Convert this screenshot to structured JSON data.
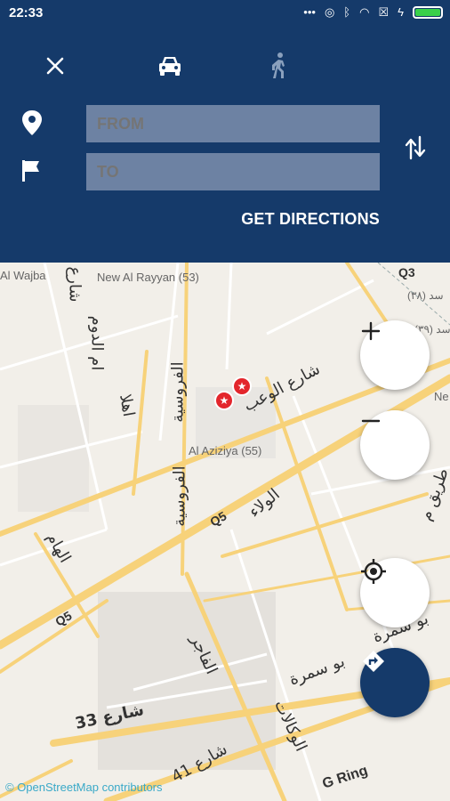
{
  "status": {
    "time": "22:33"
  },
  "header": {
    "from_placeholder": "FROM",
    "to_placeholder": "TO",
    "get_directions": "GET DIRECTIONS"
  },
  "map": {
    "labels": {
      "al_wajba": "Al Wajba",
      "new_al_rayyan": "New Al Rayyan (53)",
      "al_aziziya": "Al Aziziya (55)",
      "q3": "Q3",
      "ne": "Ne",
      "q5_1": "Q5",
      "q5_2": "Q5",
      "g_ring": "G Ring",
      "ar_shara": "شارع",
      "ar_um_aldoom": "ام الدوم",
      "ar_alfurousiya_1": "الفروسية",
      "ar_alfurousiya_2": "الفروسية",
      "ar_alwaab": "شارع الوعب",
      "ar_ahla": "اهلا",
      "ar_alwalaa": "الولاء",
      "ar_alham": "الهام",
      "ar_tariq": "طريق م",
      "ar_abu_samra_1": "بو سمرة",
      "ar_abu_samra_2": "بو سمرة",
      "ar_alfajer": "الفاجر",
      "ar_alwakalat": "الوكالات",
      "ar_street33": "شارع 33",
      "ar_street41": "شارع 41",
      "ar_right1": "سد (٣٨)",
      "ar_right2": "سد (٣٩)"
    },
    "attribution": "© OpenStreetMap contributors"
  },
  "icons": {
    "close": "close-icon",
    "car": "car-icon",
    "walk": "walk-icon",
    "pin": "location-pin-icon",
    "flag": "flag-icon",
    "swap": "swap-icon",
    "zoom_in": "plus-icon",
    "zoom_out": "minus-icon",
    "locate": "locate-icon",
    "directions": "directions-icon"
  },
  "colors": {
    "header": "#153a6a",
    "road": "#f7d27a",
    "marker": "#e3262c",
    "field": "#6d82a3"
  }
}
